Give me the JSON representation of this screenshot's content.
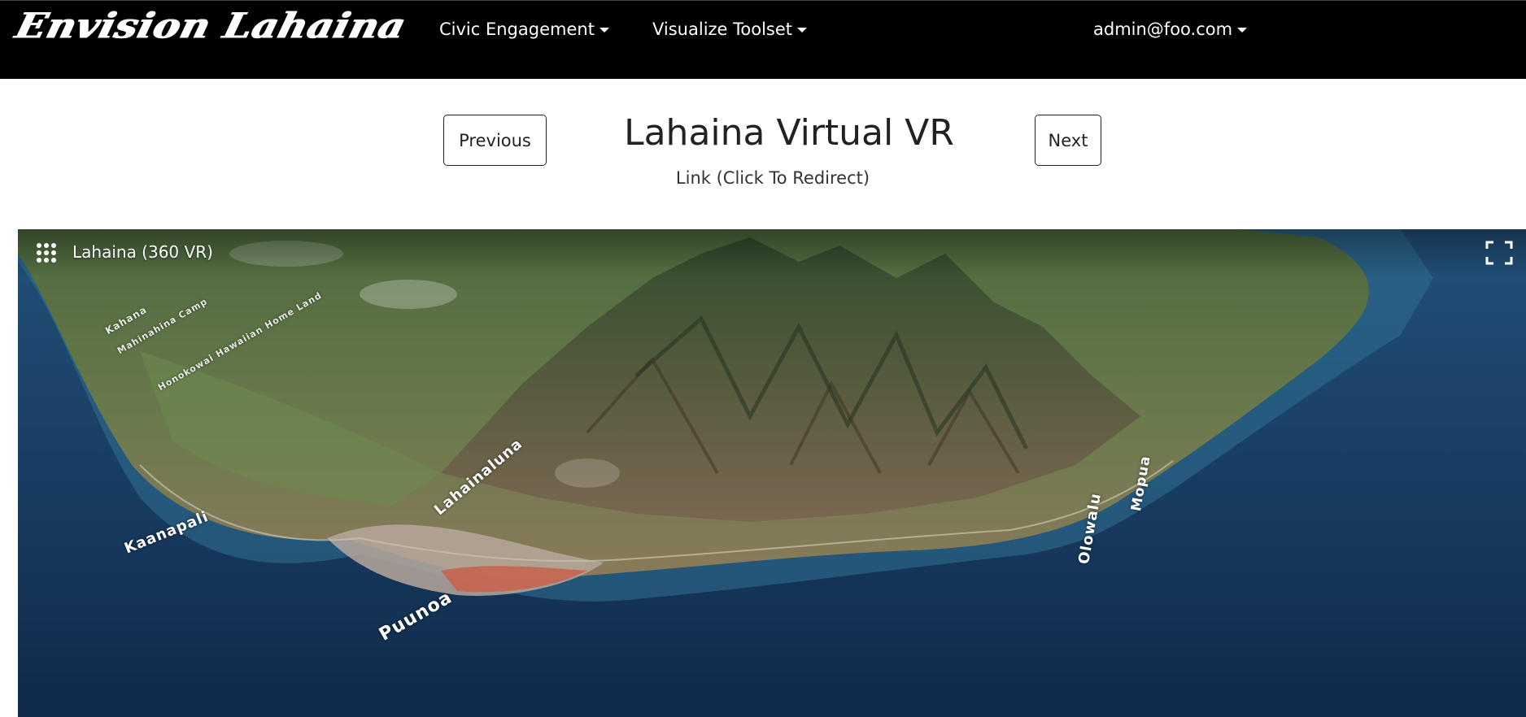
{
  "navbar": {
    "brand": "Envision Lahaina",
    "civic_label": "Civic Engagement",
    "toolset_label": "Visualize Toolset",
    "user_label": "admin@foo.com"
  },
  "header": {
    "previous_label": "Previous",
    "title": "Lahaina Virtual VR",
    "link_label": "Link (Click To Redirect)",
    "next_label": "Next"
  },
  "viewer": {
    "scene_label": "Lahaina (360 VR)",
    "menu_icon": "grid-icon",
    "fullscreen_icon": "fullscreen-icon",
    "map_labels": {
      "kaanapali": "Kaanapali",
      "lahainaluna": "Lahainaluna",
      "puunoa": "Puunoa",
      "olowalu": "Olowalu",
      "mopua": "Mopua",
      "kahana": "Kahana",
      "homeland": "Honokowai Hawaiian Home Land",
      "mahinahina": "Mahinahina Camp"
    }
  },
  "colors": {
    "navbar_bg": "#000000",
    "ocean": "#1b3a5e",
    "land": "#5f7448"
  }
}
